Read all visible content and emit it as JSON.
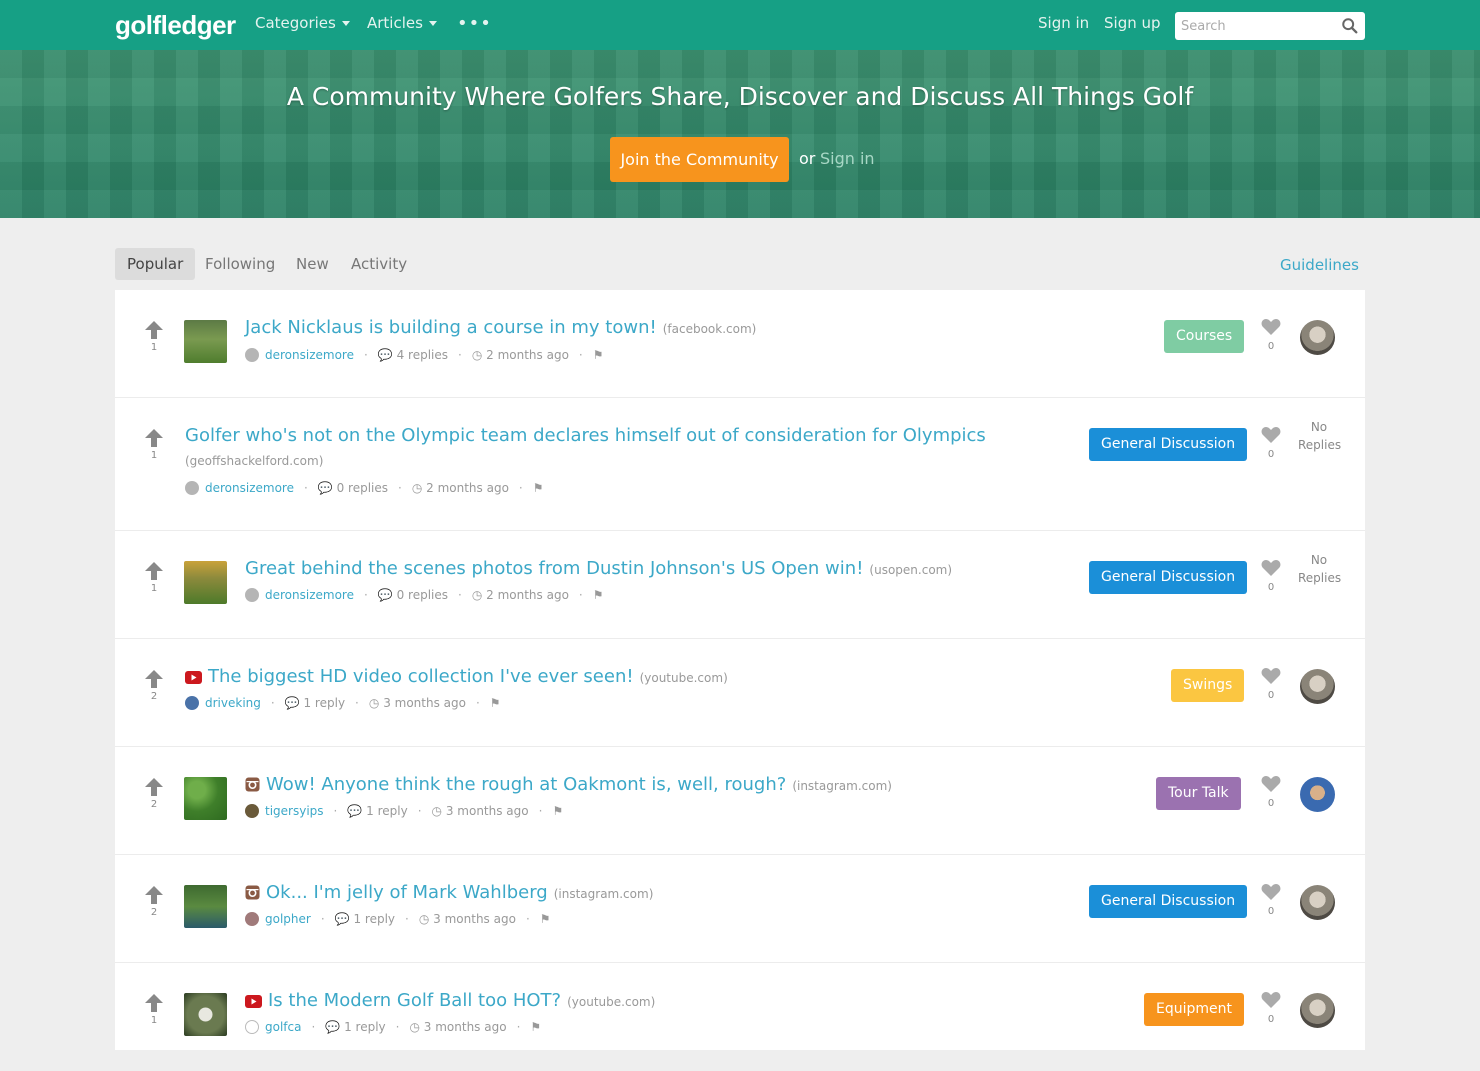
{
  "nav": {
    "logo": "golfledger",
    "categories_label": "Categories",
    "articles_label": "Articles",
    "more_label": "•••",
    "signin_label": "Sign in",
    "signup_label": "Sign up",
    "search_placeholder": "Search"
  },
  "hero": {
    "title": "A Community Where Golfers Share, Discover and Discuss All Things Golf",
    "join_label": "Join the Community",
    "or_label": "or",
    "signin_label": "Sign in"
  },
  "tabs": {
    "popular": "Popular",
    "following": "Following",
    "new": "New",
    "activity": "Activity",
    "guidelines": "Guidelines"
  },
  "colors": {
    "brand": "#16a085",
    "link": "#3ca8c8",
    "join_button": "#f7941d",
    "courses": "#7fcca3",
    "general_discussion": "#1b8fd8",
    "swings": "#fbc641",
    "tour_talk": "#9b72b0",
    "equipment": "#f7941d"
  },
  "posts": [
    {
      "votes": "1",
      "title": "Jack Nicklaus is building a course in my town!",
      "domain": "(facebook.com)",
      "author": "deronsizemore",
      "replies": "4 replies",
      "time": "2 months ago",
      "category": "Courses",
      "likes": "0",
      "no_replies_1": "",
      "no_replies_2": "",
      "media_icon": ""
    },
    {
      "votes": "1",
      "title": "Golfer who's not on the Olympic team declares himself out of consideration for Olympics",
      "domain": "(geoffshackelford.com)",
      "author": "deronsizemore",
      "replies": "0 replies",
      "time": "2 months ago",
      "category": "General Discussion",
      "likes": "0",
      "no_replies_1": "No",
      "no_replies_2": "Replies",
      "media_icon": ""
    },
    {
      "votes": "1",
      "title": "Great behind the scenes photos from Dustin Johnson's US Open win!",
      "domain": "(usopen.com)",
      "author": "deronsizemore",
      "replies": "0 replies",
      "time": "2 months ago",
      "category": "General Discussion",
      "likes": "0",
      "no_replies_1": "No",
      "no_replies_2": "Replies",
      "media_icon": ""
    },
    {
      "votes": "2",
      "title": "The biggest HD video collection I've ever seen!",
      "domain": "(youtube.com)",
      "author": "driveking",
      "replies": "1 reply",
      "time": "3 months ago",
      "category": "Swings",
      "likes": "0",
      "no_replies_1": "",
      "no_replies_2": "",
      "media_icon": "youtube-icon"
    },
    {
      "votes": "2",
      "title": "Wow! Anyone think the rough at Oakmont is, well, rough?",
      "domain": "(instagram.com)",
      "author": "tigersyips",
      "replies": "1 reply",
      "time": "3 months ago",
      "category": "Tour Talk",
      "likes": "0",
      "no_replies_1": "",
      "no_replies_2": "",
      "media_icon": "instagram-icon"
    },
    {
      "votes": "2",
      "title": "Ok... I'm jelly of Mark Wahlberg",
      "domain": "(instagram.com)",
      "author": "golpher",
      "replies": "1 reply",
      "time": "3 months ago",
      "category": "General Discussion",
      "likes": "0",
      "no_replies_1": "",
      "no_replies_2": "",
      "media_icon": "instagram-icon"
    },
    {
      "votes": "1",
      "title": "Is the Modern Golf Ball too HOT?",
      "domain": "(youtube.com)",
      "author": "golfca",
      "replies": "1 reply",
      "time": "3 months ago",
      "category": "Equipment",
      "likes": "0",
      "no_replies_1": "",
      "no_replies_2": "",
      "media_icon": "youtube-icon"
    }
  ]
}
